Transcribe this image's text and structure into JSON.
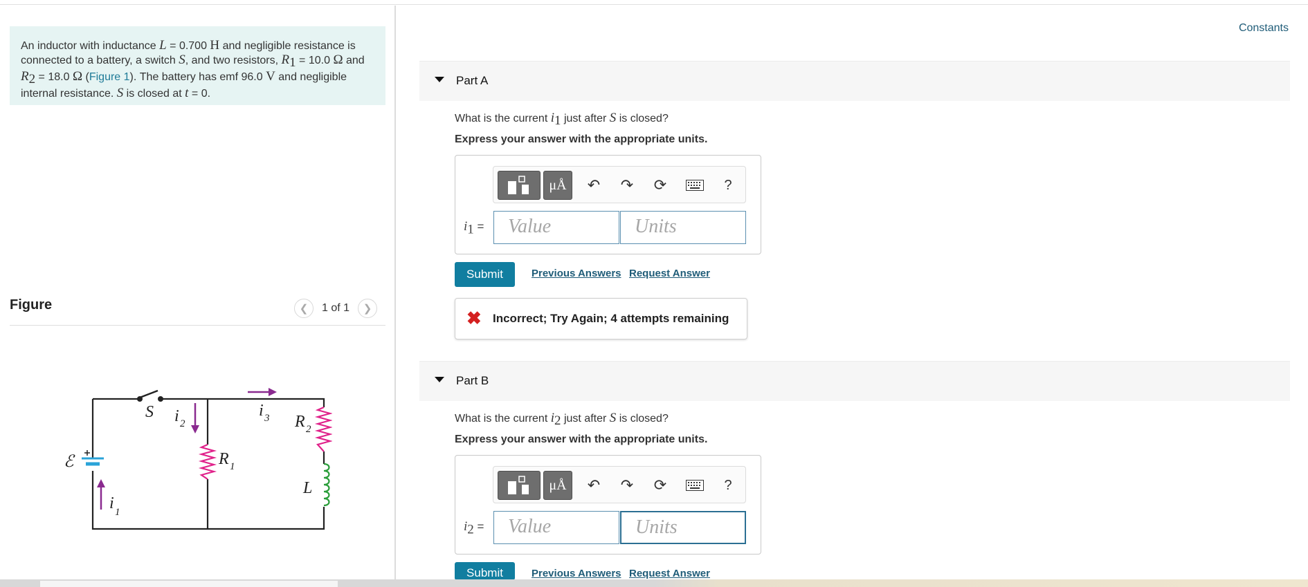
{
  "header": {
    "constants_link": "Constants"
  },
  "problem": {
    "text_1": "An inductor with inductance ",
    "L_sym": "L",
    "text_2": " = 0.700 ",
    "L_unit": "H",
    "text_3": " and negligible resistance is connected to a battery, a switch ",
    "S_sym": "S",
    "text_4": ", and two resistors, ",
    "R1_sym": "R",
    "R1_sub": "1",
    "text_5": " = 10.0 ",
    "ohm": "Ω",
    "text_6": " and ",
    "R2_sym": "R",
    "R2_sub": "2",
    "text_7": " = 18.0 ",
    "text_8": " (",
    "figure_link": "Figure 1",
    "text_9": "). The battery has emf 96.0 ",
    "V_unit": "V",
    "text_10": " and negligible internal resistance. ",
    "text_11": " is closed at ",
    "t_sym": "t",
    "text_12": " = 0."
  },
  "figure": {
    "title": "Figure",
    "counter": "1 of 1",
    "prev_icon": "chevron-left-icon",
    "next_icon": "chevron-right-icon",
    "labels": {
      "switch": "S",
      "emf": "ℰ",
      "i1": "i",
      "i1_sub": "1",
      "i2": "i",
      "i2_sub": "2",
      "i3": "i",
      "i3_sub": "3",
      "R1": "R",
      "R1_sub": "1",
      "R2": "R",
      "R2_sub": "2",
      "L": "L"
    },
    "colors": {
      "wire": "#222222",
      "resistor": "#e0218a",
      "inductor": "#2a9d3a",
      "arrow": "#8a2a8f",
      "battery": "#2aa3d8"
    }
  },
  "parts": [
    {
      "label": "Part A",
      "question_pre": "What is the current ",
      "var": "i",
      "var_sub": "1",
      "question_mid": " just after ",
      "S_sym": "S",
      "question_post": " is closed?",
      "instruction": "Express your answer with the appropriate units.",
      "eq_var": "i",
      "eq_sub": "1",
      "eq_sign": " =",
      "value_placeholder": "Value",
      "units_placeholder": "Units",
      "submit": "Submit",
      "previous_answers": "Previous Answers",
      "request_answer": "Request Answer",
      "feedback": "Incorrect; Try Again; 4 attempts remaining",
      "feedback_icon": "x-icon"
    },
    {
      "label": "Part B",
      "question_pre": "What is the current ",
      "var": "i",
      "var_sub": "2",
      "question_mid": " just after ",
      "S_sym": "S",
      "question_post": " is closed?",
      "instruction": "Express your answer with the appropriate units.",
      "eq_var": "i",
      "eq_sub": "2",
      "eq_sign": " =",
      "value_placeholder": "Value",
      "units_placeholder": "Units",
      "submit": "Submit",
      "previous_answers": "Previous Answers",
      "request_answer": "Request Answer"
    }
  ],
  "toolbar": {
    "template_icon": "template-icon",
    "units_button": "μÅ",
    "undo_icon": "undo-icon",
    "redo_icon": "redo-icon",
    "reset_icon": "reset-icon",
    "keyboard_icon": "keyboard-icon",
    "help": "?"
  }
}
